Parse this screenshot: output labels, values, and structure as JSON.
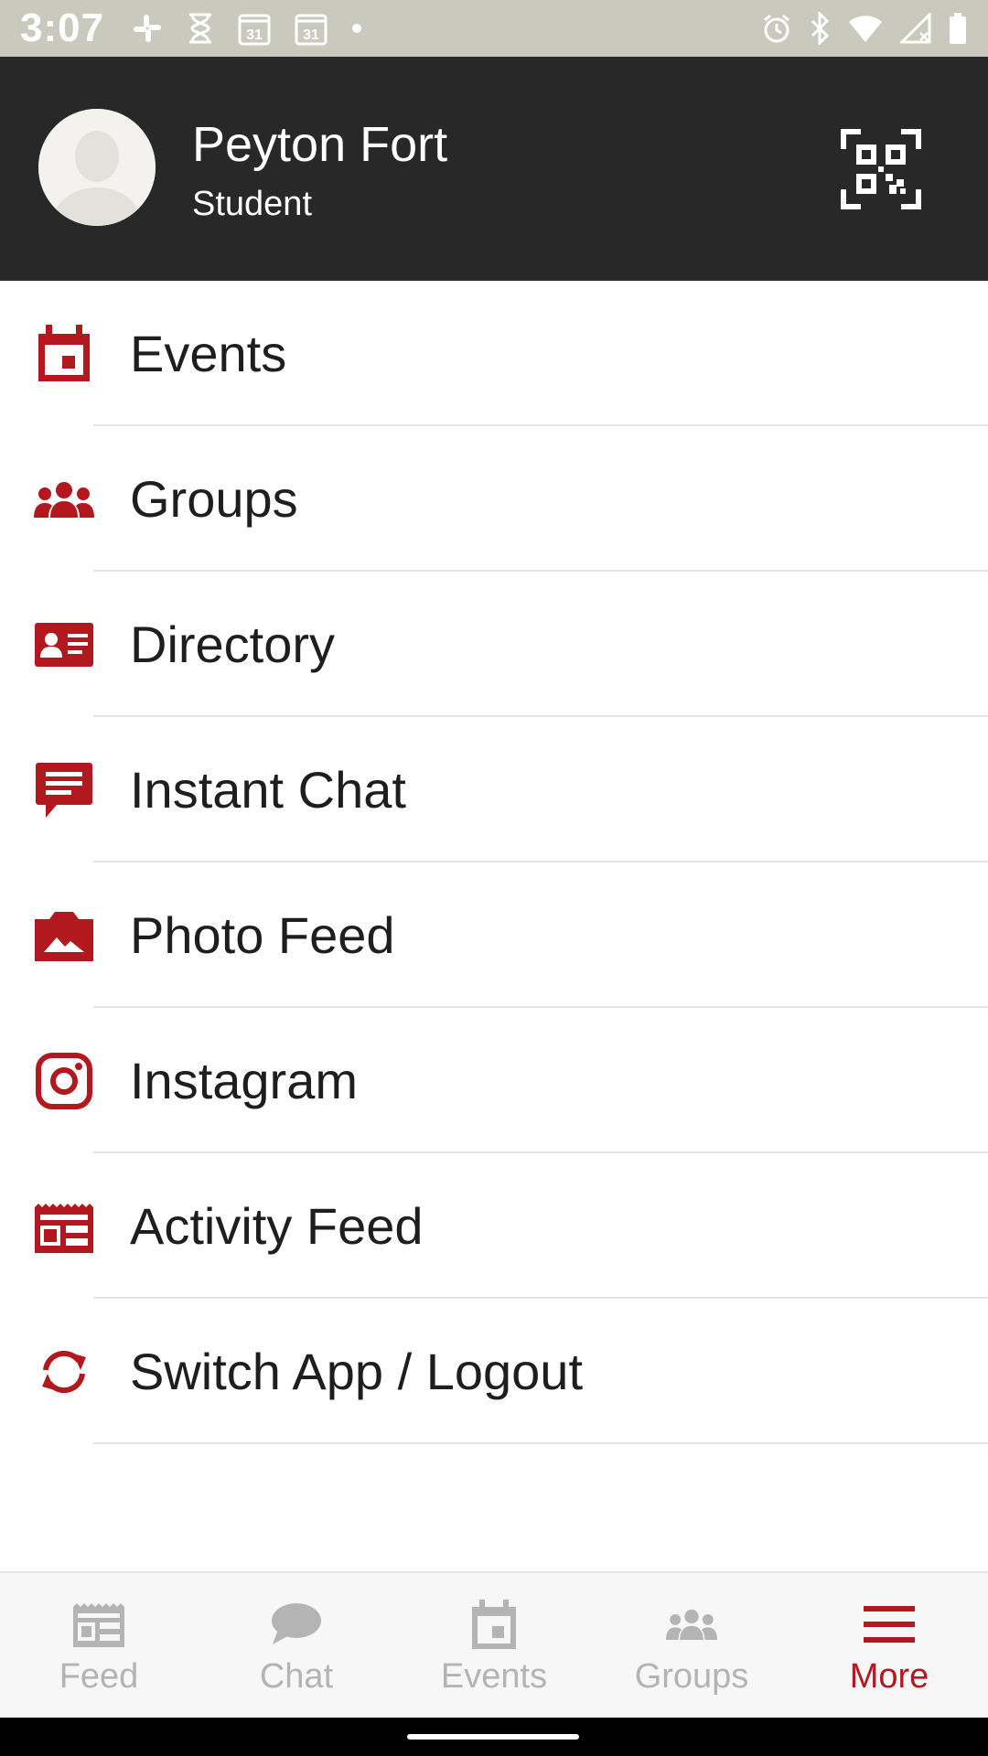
{
  "status_bar": {
    "time": "3:07",
    "left_icons": [
      "slack-icon",
      "hourglass-icon",
      "calendar-31-icon",
      "calendar-31-icon",
      "dot-icon"
    ],
    "calendar_day": "31",
    "right_icons": [
      "alarm-icon",
      "bluetooth-icon",
      "wifi-icon",
      "cell-signal-icon",
      "battery-icon"
    ]
  },
  "profile": {
    "name": "Peyton Fort",
    "role": "Student"
  },
  "menu": [
    {
      "label": "Events",
      "icon": "calendar-icon"
    },
    {
      "label": "Groups",
      "icon": "people-icon"
    },
    {
      "label": "Directory",
      "icon": "id-card-icon"
    },
    {
      "label": "Instant Chat",
      "icon": "chat-icon"
    },
    {
      "label": "Photo Feed",
      "icon": "photo-icon"
    },
    {
      "label": "Instagram",
      "icon": "instagram-icon"
    },
    {
      "label": "Activity Feed",
      "icon": "activity-feed-icon"
    },
    {
      "label": "Switch App / Logout",
      "icon": "switch-icon"
    }
  ],
  "bottom_nav": [
    {
      "label": "Feed",
      "icon": "feed-icon",
      "active": false
    },
    {
      "label": "Chat",
      "icon": "chat-bubble-icon",
      "active": false
    },
    {
      "label": "Events",
      "icon": "calendar-icon",
      "active": false
    },
    {
      "label": "Groups",
      "icon": "people-icon",
      "active": false
    },
    {
      "label": "More",
      "icon": "menu-icon",
      "active": true
    }
  ],
  "colors": {
    "accent": "#b3181e",
    "header_bg": "#282828",
    "status_bar_bg": "#c9c9bd",
    "inactive": "#b4b4b4"
  }
}
